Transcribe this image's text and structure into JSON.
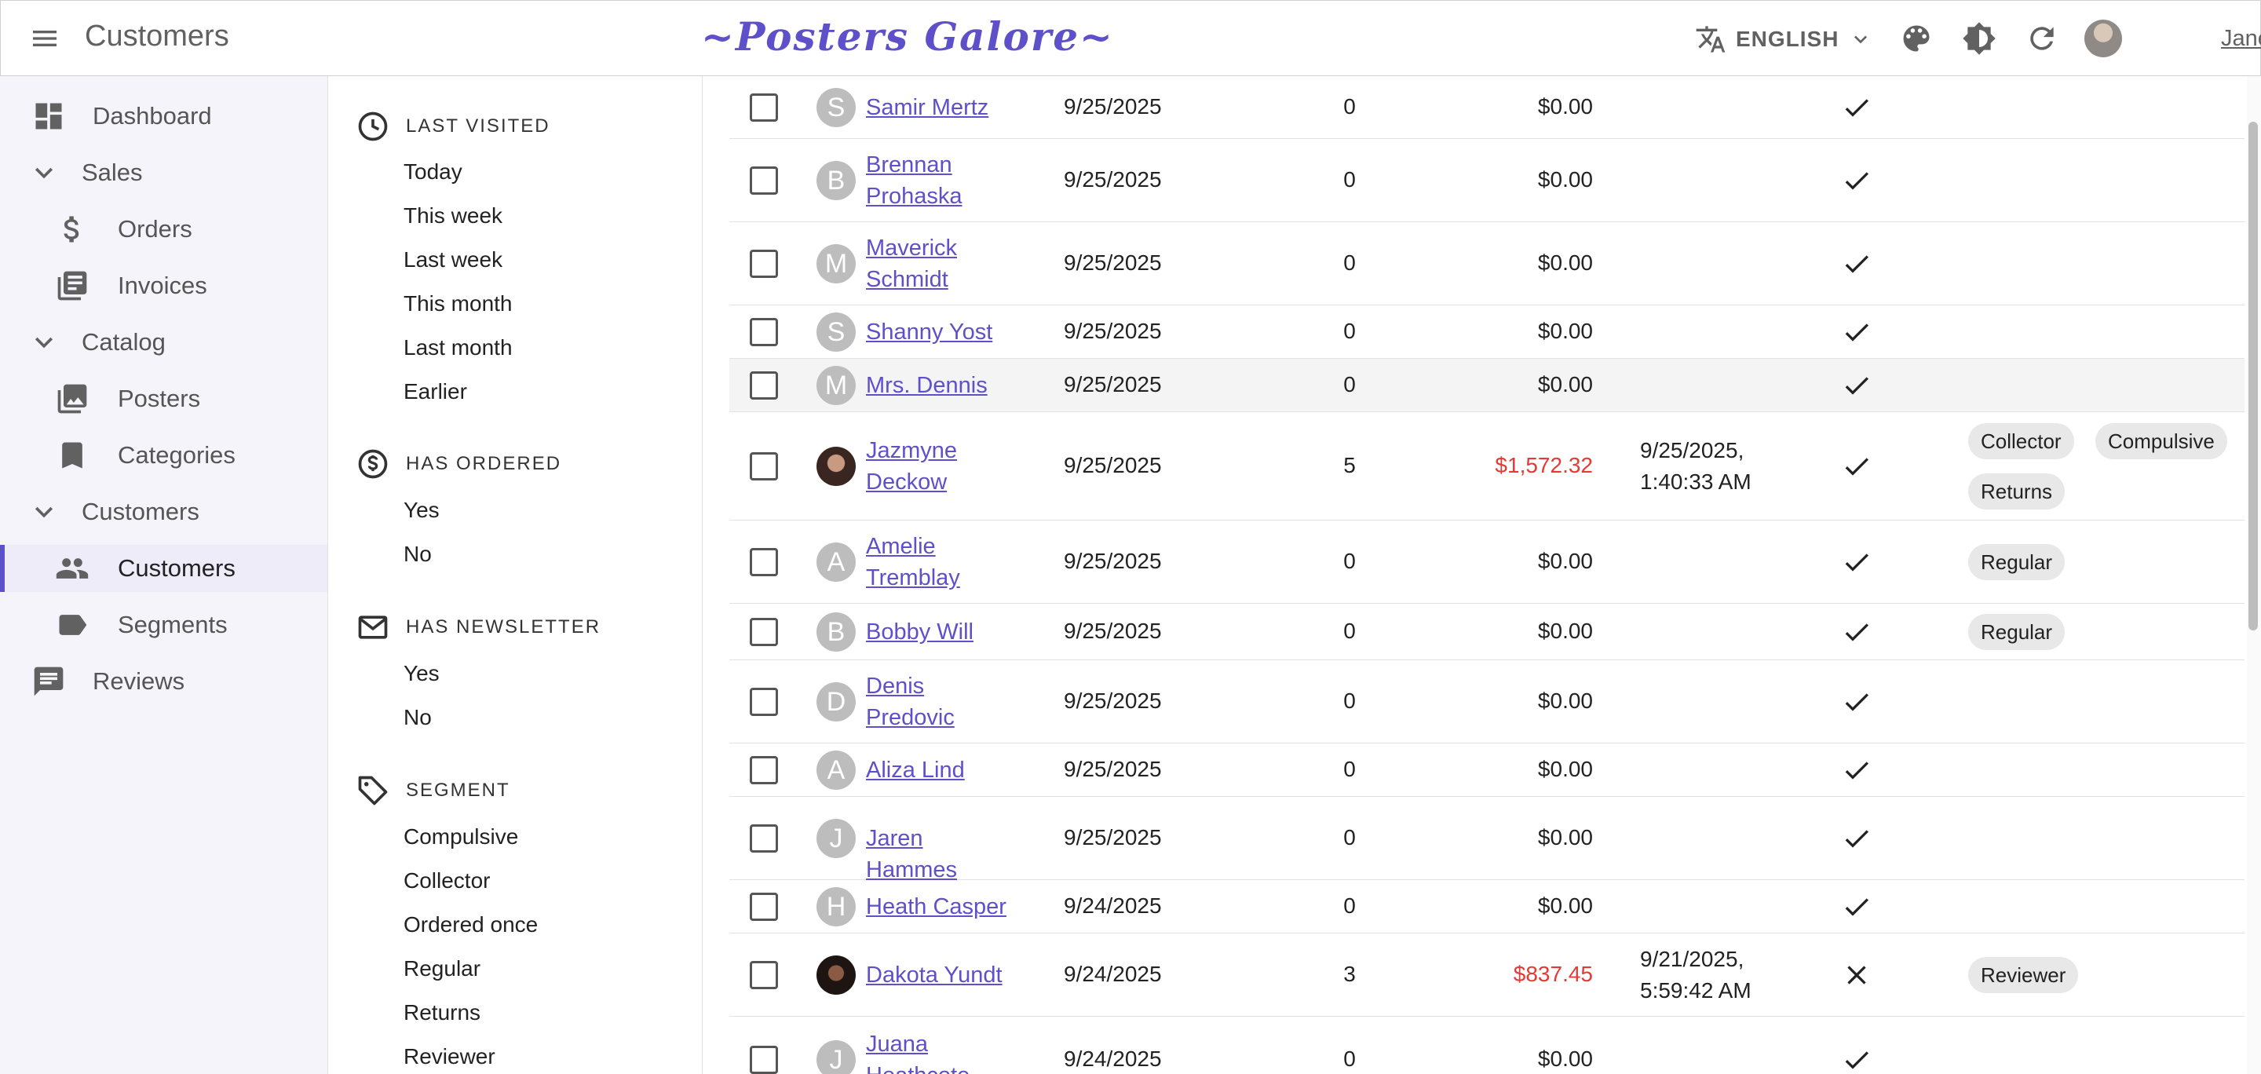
{
  "app_bar": {
    "title": "Customers",
    "brand": "~Posters Galore~",
    "language": "ENGLISH",
    "user_name": "Jane Doe"
  },
  "sidebar": {
    "items": [
      {
        "label": "Dashboard",
        "icon": "dashboard-icon"
      },
      {
        "label": "Sales",
        "icon": "chevron-down-icon"
      },
      {
        "label": "Orders",
        "icon": "dollar-icon"
      },
      {
        "label": "Invoices",
        "icon": "invoice-icon"
      },
      {
        "label": "Catalog",
        "icon": "chevron-down-icon"
      },
      {
        "label": "Posters",
        "icon": "image-icon"
      },
      {
        "label": "Categories",
        "icon": "bookmark-icon"
      },
      {
        "label": "Customers",
        "icon": "chevron-down-icon"
      },
      {
        "label": "Customers",
        "icon": "people-icon",
        "active": true
      },
      {
        "label": "Segments",
        "icon": "label-icon"
      },
      {
        "label": "Reviews",
        "icon": "comment-icon"
      }
    ]
  },
  "filters": {
    "last_visited": {
      "title": "LAST VISITED",
      "options": [
        "Today",
        "This week",
        "Last week",
        "This month",
        "Last month",
        "Earlier"
      ]
    },
    "has_ordered": {
      "title": "HAS ORDERED",
      "options": [
        "Yes",
        "No"
      ]
    },
    "has_newsletter": {
      "title": "HAS NEWSLETTER",
      "options": [
        "Yes",
        "No"
      ]
    },
    "segment": {
      "title": "SEGMENT",
      "options": [
        "Compulsive",
        "Collector",
        "Ordered once",
        "Regular",
        "Returns",
        "Reviewer"
      ]
    }
  },
  "table": {
    "rows": [
      {
        "initial": "S",
        "name": "Samir Mertz",
        "date": "9/25/2025",
        "orders": "0",
        "spent": "$0.00",
        "last_seen": "",
        "newsletter": true,
        "segments": []
      },
      {
        "initial": "B",
        "name": "Brennan Prohaska",
        "date": "9/25/2025",
        "orders": "0",
        "spent": "$0.00",
        "last_seen": "",
        "newsletter": true,
        "segments": []
      },
      {
        "initial": "M",
        "name": "Maverick Schmidt",
        "date": "9/25/2025",
        "orders": "0",
        "spent": "$0.00",
        "last_seen": "",
        "newsletter": true,
        "segments": []
      },
      {
        "initial": "S",
        "name": "Shanny Yost",
        "date": "9/25/2025",
        "orders": "0",
        "spent": "$0.00",
        "last_seen": "",
        "newsletter": true,
        "segments": []
      },
      {
        "initial": "M",
        "name": "Mrs. Dennis",
        "date": "9/25/2025",
        "orders": "0",
        "spent": "$0.00",
        "last_seen": "",
        "newsletter": true,
        "segments": []
      },
      {
        "initial": "",
        "name": "Jazmyne Deckow",
        "date": "9/25/2025",
        "orders": "5",
        "spent": "$1,572.32",
        "last_seen": "9/25/2025, 1:40:33 AM",
        "newsletter": true,
        "segments": [
          "Collector",
          "Compulsive",
          "Returns"
        ]
      },
      {
        "initial": "A",
        "name": "Amelie Tremblay",
        "date": "9/25/2025",
        "orders": "0",
        "spent": "$0.00",
        "last_seen": "",
        "newsletter": true,
        "segments": [
          "Regular"
        ]
      },
      {
        "initial": "B",
        "name": "Bobby Will",
        "date": "9/25/2025",
        "orders": "0",
        "spent": "$0.00",
        "last_seen": "",
        "newsletter": true,
        "segments": [
          "Regular"
        ]
      },
      {
        "initial": "D",
        "name": "Denis Predovic",
        "date": "9/25/2025",
        "orders": "0",
        "spent": "$0.00",
        "last_seen": "",
        "newsletter": true,
        "segments": []
      },
      {
        "initial": "A",
        "name": "Aliza Lind",
        "date": "9/25/2025",
        "orders": "0",
        "spent": "$0.00",
        "last_seen": "",
        "newsletter": true,
        "segments": []
      },
      {
        "initial": "J",
        "name": "Jaren Hammes",
        "date": "9/25/2025",
        "orders": "0",
        "spent": "$0.00",
        "last_seen": "",
        "newsletter": true,
        "segments": []
      },
      {
        "initial": "H",
        "name": "Heath Casper",
        "date": "9/24/2025",
        "orders": "0",
        "spent": "$0.00",
        "last_seen": "",
        "newsletter": true,
        "segments": []
      },
      {
        "initial": "",
        "name": "Dakota Yundt",
        "date": "9/24/2025",
        "orders": "3",
        "spent": "$837.45",
        "last_seen": "9/21/2025, 5:59:42 AM",
        "newsletter": false,
        "segments": [
          "Reviewer"
        ]
      },
      {
        "initial": "J",
        "name": "Juana Heathcote",
        "date": "9/24/2025",
        "orders": "0",
        "spent": "$0.00",
        "last_seen": "",
        "newsletter": true,
        "segments": []
      }
    ]
  }
}
